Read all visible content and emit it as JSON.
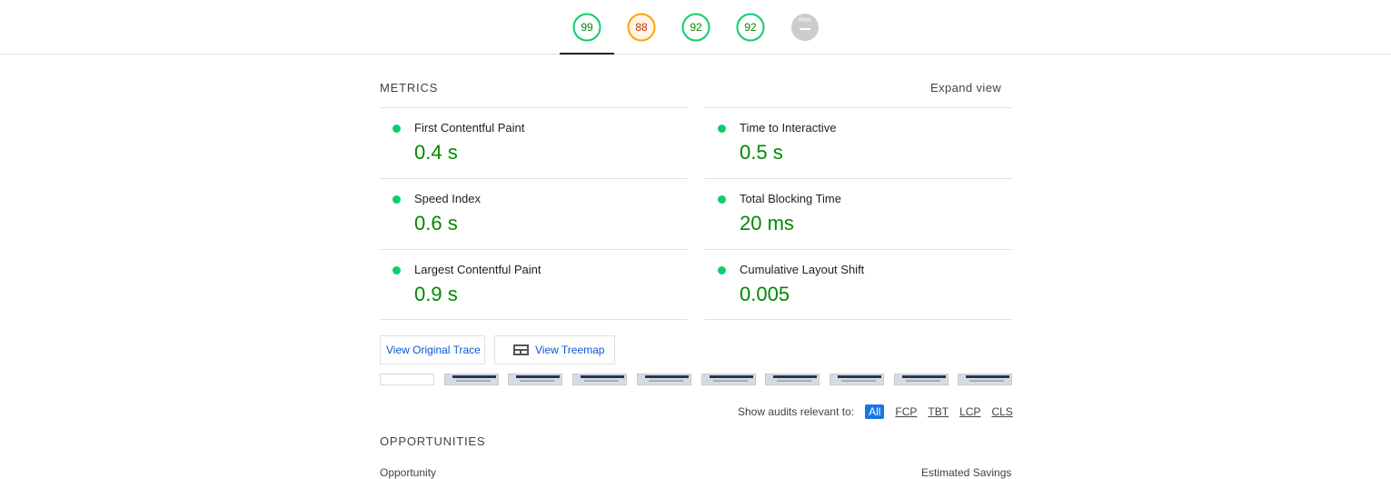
{
  "gauges": [
    {
      "score": "99",
      "status": "pass",
      "color": "#0cce6b",
      "fraction": 0.99
    },
    {
      "score": "88",
      "status": "average",
      "color": "#ffa400",
      "fraction": 0.88
    },
    {
      "score": "92",
      "status": "pass",
      "color": "#0cce6b",
      "fraction": 0.92
    },
    {
      "score": "92",
      "status": "pass",
      "color": "#0cce6b",
      "fraction": 0.92
    },
    {
      "score": "PWA",
      "status": "not-applicable",
      "color": "#cccccc",
      "fraction": 1
    }
  ],
  "metrics_section": {
    "title": "METRICS",
    "expand_label": "Expand view",
    "items": [
      {
        "label": "First Contentful Paint",
        "value": "0.4 s"
      },
      {
        "label": "Time to Interactive",
        "value": "0.5 s"
      },
      {
        "label": "Speed Index",
        "value": "0.6 s"
      },
      {
        "label": "Total Blocking Time",
        "value": "20 ms"
      },
      {
        "label": "Largest Contentful Paint",
        "value": "0.9 s"
      },
      {
        "label": "Cumulative Layout Shift",
        "value": "0.005"
      }
    ],
    "pass_color": "#0cce6b",
    "value_color": "#008800"
  },
  "buttons": {
    "view_trace": "View Original Trace",
    "view_treemap": "View Treemap",
    "treemap_icon": "treemap-icon"
  },
  "filter": {
    "label": "Show audits relevant to:",
    "options": [
      "All",
      "FCP",
      "TBT",
      "LCP",
      "CLS"
    ],
    "active": "All",
    "active_color": "#1a73e8"
  },
  "opportunities": {
    "title": "OPPORTUNITIES",
    "col_opportunity": "Opportunity",
    "col_savings": "Estimated Savings"
  }
}
